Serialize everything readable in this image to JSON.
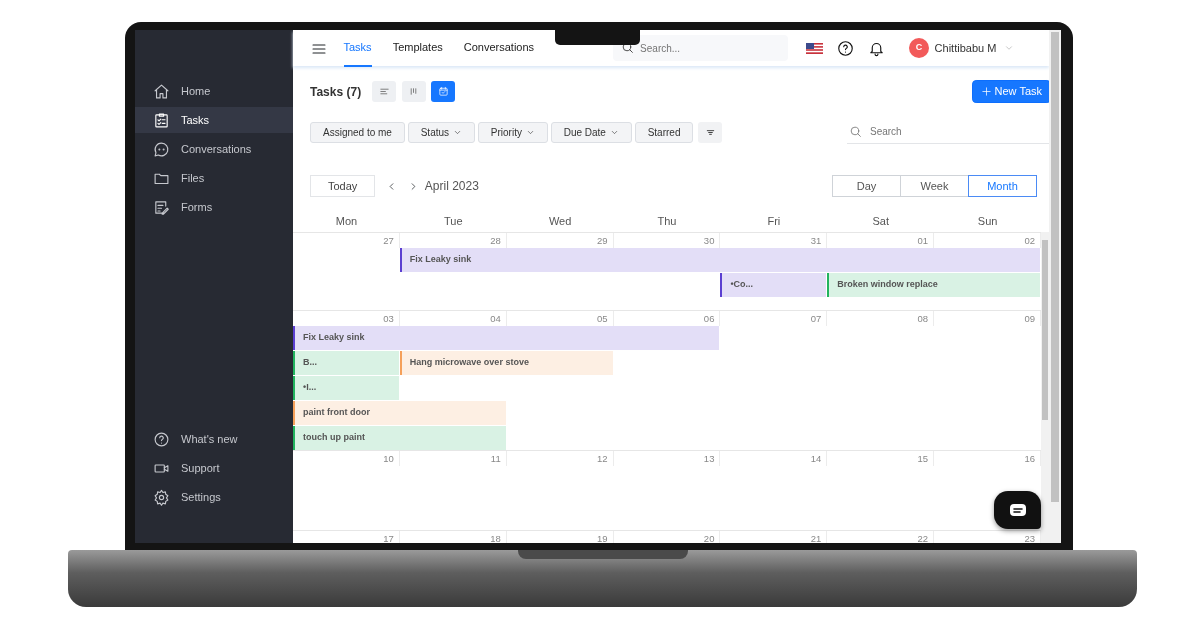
{
  "sidebar": {
    "items": [
      {
        "label": "Home",
        "selected": false
      },
      {
        "label": "Tasks",
        "selected": true
      },
      {
        "label": "Conversations",
        "selected": false
      },
      {
        "label": "Files",
        "selected": false
      },
      {
        "label": "Forms",
        "selected": false
      }
    ],
    "footer_items": [
      {
        "label": "What's new"
      },
      {
        "label": "Support"
      },
      {
        "label": "Settings"
      }
    ]
  },
  "top_bar": {
    "tabs": [
      {
        "label": "Tasks",
        "selected": true
      },
      {
        "label": "Templates",
        "selected": false
      },
      {
        "label": "Conversations",
        "selected": false
      }
    ],
    "search": {
      "placeholder": "Search..."
    },
    "user": {
      "initial": "C",
      "name": "Chittibabu M"
    }
  },
  "page": {
    "title": "Tasks (7)",
    "views": [
      {
        "selected": false
      },
      {
        "selected": false
      },
      {
        "selected": true
      }
    ],
    "new_task_button": "New Task",
    "filters": [
      {
        "label": "Assigned to me",
        "dropdown": false
      },
      {
        "label": "Status",
        "dropdown": true
      },
      {
        "label": "Priority",
        "dropdown": true
      },
      {
        "label": "Due Date",
        "dropdown": true
      },
      {
        "label": "Starred",
        "dropdown": false
      }
    ],
    "search": {
      "placeholder": "Search"
    }
  },
  "calendar": {
    "today_button": "Today",
    "period": "April 2023",
    "modes": [
      {
        "label": "Day",
        "selected": false
      },
      {
        "label": "Week",
        "selected": false
      },
      {
        "label": "Month",
        "selected": true
      }
    ],
    "weekdays": [
      "Mon",
      "Tue",
      "Wed",
      "Thu",
      "Fri",
      "Sat",
      "Sun"
    ],
    "weeks": [
      {
        "days": [
          "27",
          "28",
          "29",
          "30",
          "31",
          "01",
          "02"
        ],
        "events": [
          {
            "title": "Fix Leaky sink",
            "color": "#5b3fd1",
            "covers": [
              false,
              true,
              true,
              true,
              true,
              true,
              true
            ]
          },
          {
            "title": "•Co...",
            "color": "#5b3fd1",
            "covers": [
              false,
              false,
              false,
              false,
              true,
              false,
              false
            ]
          },
          {
            "title": "Broken window replace",
            "color": "#22b35e",
            "covers": [
              false,
              false,
              false,
              false,
              false,
              true,
              true
            ]
          }
        ]
      },
      {
        "days": [
          "03",
          "04",
          "05",
          "06",
          "07",
          "08",
          "09"
        ],
        "events": [
          {
            "title": "Fix Leaky sink",
            "color": "#5b3fd1",
            "covers": [
              true,
              true,
              true,
              true,
              false,
              false,
              false
            ]
          },
          {
            "title": "B...",
            "color": "#22b35e",
            "covers": [
              true,
              false,
              false,
              false,
              false,
              false,
              false
            ]
          },
          {
            "title": "Hang microwave over stove",
            "color": "#f5a05a",
            "covers": [
              false,
              true,
              true,
              false,
              false,
              false,
              false
            ]
          },
          {
            "title": "•I...",
            "color": "#22b35e",
            "covers": [
              true,
              false,
              false,
              false,
              false,
              false,
              false
            ]
          },
          {
            "title": "paint front door",
            "color": "#f5a05a",
            "covers": [
              true,
              true,
              false,
              false,
              false,
              false,
              false
            ]
          },
          {
            "title": "touch up paint",
            "color": "#22b35e",
            "covers": [
              true,
              true,
              false,
              false,
              false,
              false,
              false
            ]
          }
        ]
      },
      {
        "days": [
          "10",
          "11",
          "12",
          "13",
          "14",
          "15",
          "16"
        ]
      },
      {
        "days": [
          "17",
          "18",
          "19",
          "20",
          "21",
          "22",
          "23"
        ]
      }
    ]
  }
}
